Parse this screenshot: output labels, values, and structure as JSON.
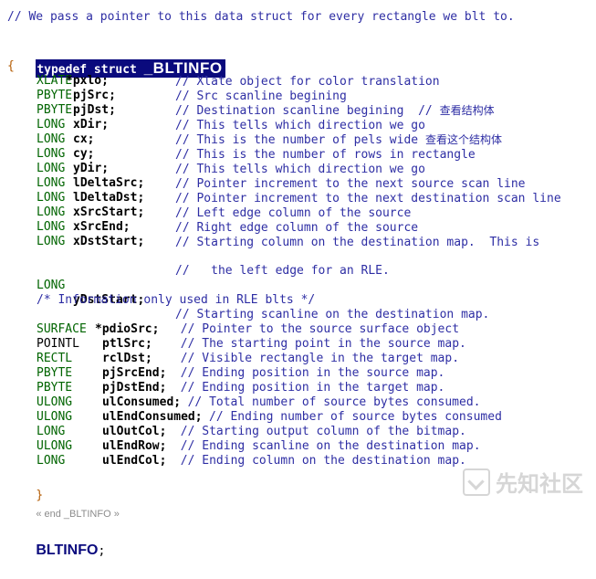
{
  "header_comment": "// We pass a pointer to this data struct for every rectangle we blt to.",
  "decl": {
    "keywords": "typedef struct ",
    "name": "_BLTINFO"
  },
  "open_brace": "{",
  "fields": [
    {
      "type": "XLATE",
      "ptr": "*",
      "name": "pxlo;",
      "comment": "// Xlate object for color translation",
      "note": ""
    },
    {
      "type": "PBYTE",
      "ptr": "",
      "name": "pjSrc;",
      "comment": "// Src scanline begining",
      "note": ""
    },
    {
      "type": "PBYTE",
      "ptr": "",
      "name": "pjDst;",
      "comment": "// Destination scanline begining  //",
      "note": "查看结构体"
    },
    {
      "type": "LONG",
      "ptr": "",
      "name": "xDir;",
      "comment": "// This tells which direction we go",
      "note": ""
    },
    {
      "type": "LONG",
      "ptr": "",
      "name": "cx;",
      "comment": "// This is the number of pels wide",
      "note": "查看这个结构体"
    },
    {
      "type": "LONG",
      "ptr": "",
      "name": "cy;",
      "comment": "// This is the number of rows in rectangle",
      "note": ""
    },
    {
      "type": "LONG",
      "ptr": "",
      "name": "yDir;",
      "comment": "// This tells which direction we go",
      "note": ""
    },
    {
      "type": "LONG",
      "ptr": "",
      "name": "lDeltaSrc;",
      "comment": "// Pointer increment to the next source scan line",
      "note": ""
    },
    {
      "type": "LONG",
      "ptr": "",
      "name": "lDeltaDst;",
      "comment": "// Pointer increment to the next destination scan line",
      "note": ""
    },
    {
      "type": "LONG",
      "ptr": "",
      "name": "xSrcStart;",
      "comment": "// Left edge column of the source",
      "note": ""
    },
    {
      "type": "LONG",
      "ptr": "",
      "name": "xSrcEnd;",
      "comment": "// Right edge column of the source",
      "note": ""
    },
    {
      "type": "LONG",
      "ptr": "",
      "name": "xDstStart;",
      "comment": "// Starting column on the destination map.  This is",
      "note": ""
    }
  ],
  "continuation_comment": "//   the left edge for an RLE.",
  "field_ydst": {
    "type": "LONG",
    "name": "yDstStart;",
    "comment": "// Starting scanline on the destination map."
  },
  "section_comment": "/* Information only used in RLE blts */",
  "rle_fields": [
    {
      "type": "SURFACE",
      "ptr": "*",
      "name": "pdioSrc;",
      "comment": "// Pointer to the source surface object"
    },
    {
      "type": "POINTL",
      "ptr": "",
      "name": "ptlSrc;",
      "comment": "// The starting point in the source map."
    },
    {
      "type": "RECTL",
      "ptr": "",
      "name": "rclDst;",
      "comment": "// Visible rectangle in the target map."
    },
    {
      "type": "PBYTE",
      "ptr": "",
      "name": "pjSrcEnd;",
      "comment": "// Ending position in the source map."
    },
    {
      "type": "PBYTE",
      "ptr": "",
      "name": "pjDstEnd;",
      "comment": "// Ending position in the target map."
    },
    {
      "type": "ULONG",
      "ptr": "",
      "name": "ulConsumed;",
      "comment": "// Total number of source bytes consumed."
    },
    {
      "type": "ULONG",
      "ptr": "",
      "name": "ulEndConsumed;",
      "comment": "// Ending number of source bytes consumed"
    },
    {
      "type": "LONG",
      "ptr": "",
      "name": "ulOutCol;",
      "comment": "// Starting output column of the bitmap."
    },
    {
      "type": "ULONG",
      "ptr": "",
      "name": "ulEndRow;",
      "comment": "// Ending scanline on the destination map."
    },
    {
      "type": "LONG",
      "ptr": "",
      "name": "ulEndCol;",
      "comment": "// Ending column on the destination map."
    }
  ],
  "close_brace": "}",
  "end_marker": "« end _BLTINFO »",
  "end_name": "BLTINFO",
  "end_semicolon": ";",
  "watermark_text": "先知社区",
  "watermark_icon": "xianzhi-logo-icon",
  "colors": {
    "comment": "#2e2ea4",
    "type": "#006400",
    "header_bg": "#0a0a7d"
  }
}
